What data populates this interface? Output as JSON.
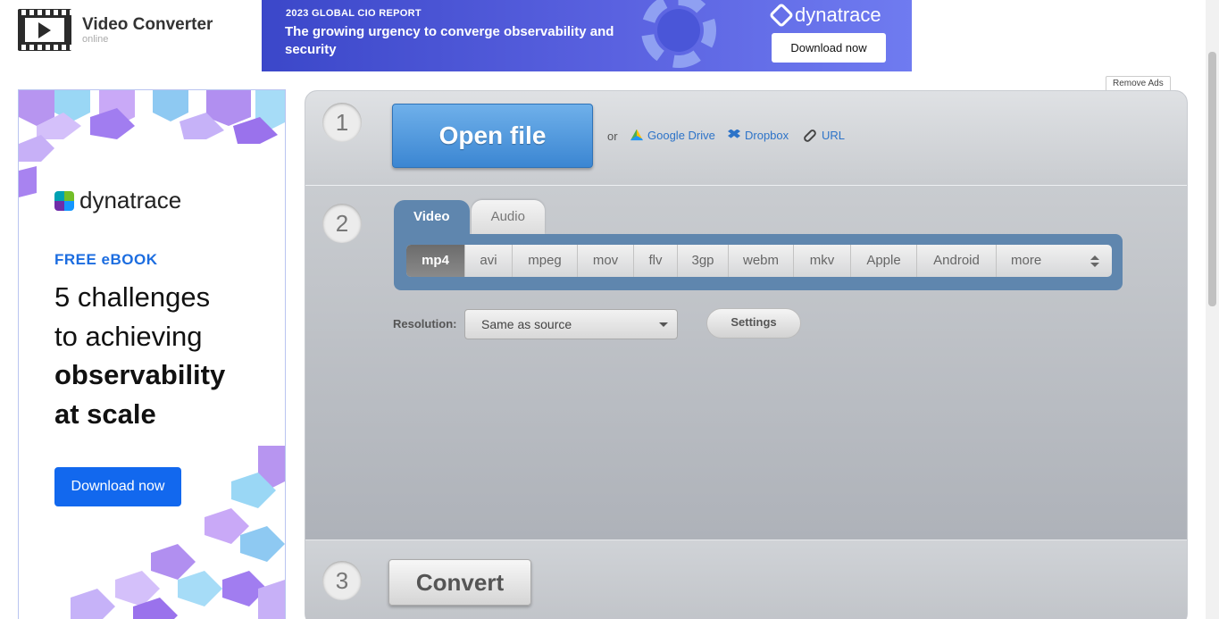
{
  "header": {
    "title": "Video Converter",
    "subtitle": "online"
  },
  "top_ad": {
    "kicker": "2023 GLOBAL CIO REPORT",
    "headline": "The growing urgency to converge observability and security",
    "brand": "dynatrace",
    "button": "Download now"
  },
  "side_ad": {
    "brand": "dynatrace",
    "tag": "FREE eBOOK",
    "lines": [
      "5 challenges",
      "to achieving",
      "observability",
      "at scale"
    ],
    "button": "Download now"
  },
  "remove_ads": "Remove Ads",
  "steps": {
    "step1": {
      "number": "1",
      "open_file": "Open file",
      "or": "or",
      "google_drive": "Google Drive",
      "dropbox": "Dropbox",
      "url": "URL"
    },
    "step2": {
      "number": "2",
      "tabs": [
        "Video",
        "Audio"
      ],
      "formats": [
        "mp4",
        "avi",
        "mpeg",
        "mov",
        "flv",
        "3gp",
        "webm",
        "mkv",
        "Apple",
        "Android",
        "more"
      ],
      "selected_format": "mp4",
      "resolution_label": "Resolution:",
      "resolution_value": "Same as source",
      "settings": "Settings"
    },
    "step3": {
      "number": "3",
      "convert": "Convert"
    }
  },
  "colors": {
    "accent_blue": "#3b86d2",
    "tab_blue": "#5f86ae",
    "ad_blue": "#1268ee"
  }
}
